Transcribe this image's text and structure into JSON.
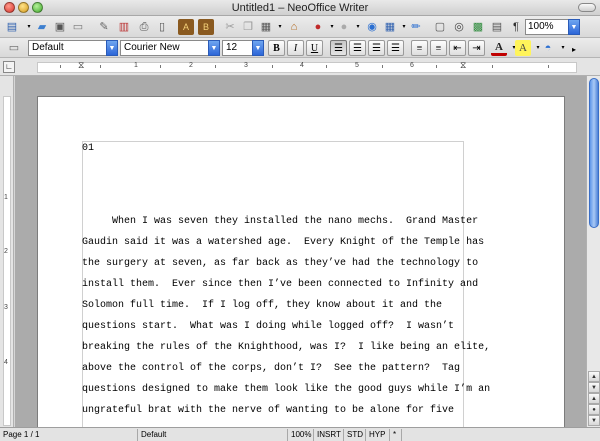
{
  "window": {
    "title": "Untitled1 – NeoOffice Writer"
  },
  "toolbar": {
    "zoom": "100%"
  },
  "formatting": {
    "style": "Default",
    "font": "Courier New",
    "size": "12",
    "bold": "B",
    "italic": "I",
    "underline": "U"
  },
  "ruler": {
    "horizontal_numbers": [
      "1",
      "2",
      "3",
      "4",
      "5",
      "6"
    ],
    "vertical_numbers": [
      "1",
      "2",
      "3",
      "4"
    ]
  },
  "document": {
    "lines": [
      "01",
      "",
      "",
      "",
      "     When I was seven they installed the nano mechs.  Grand Master",
      "Gaudin said it was a watershed age.  Every Knight of the Temple has",
      "the surgery at seven, as far back as they’ve had the technology to",
      "install them.  Ever since then I’ve been connected to Infinity and",
      "Solomon full time.  If I log off, they know about it and the",
      "questions start.  What was I doing while logged off?  I wasn’t",
      "breaking the rules of the Knighthood, was I?  I like being an elite,",
      "above the control of the corps, don’t I?  See the pattern?  Tag",
      "questions designed to make them look like the good guys while I’m an",
      "ungrateful brat with the nerve of wanting to be alone for five"
    ]
  },
  "status": {
    "page": "Page 1 / 1",
    "style": "Default",
    "zoom": "100%",
    "insert_mode": "INSRT",
    "selection_mode": "STD",
    "hyphenation": "HYP",
    "modified": "*"
  }
}
